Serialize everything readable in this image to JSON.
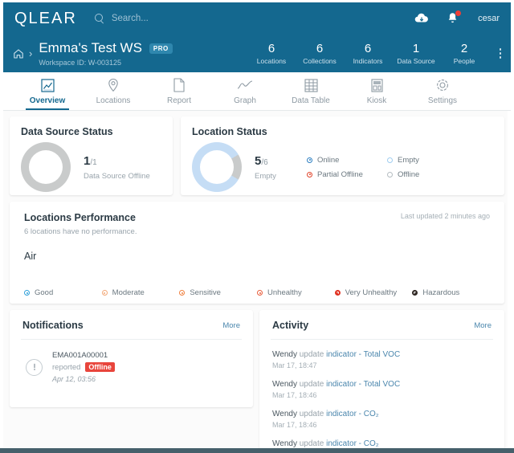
{
  "topbar": {
    "logo": "QLEAR",
    "search_placeholder": "Search...",
    "search_value": "",
    "search_icon": "search-icon",
    "cloud_icon": "cloud-download-icon",
    "bell_icon": "bell-icon",
    "username": "cesar"
  },
  "workspace": {
    "home_icon": "home-icon",
    "breadcrumb_chevron": "chevron-right-icon",
    "title": "Emma's Test WS",
    "badge": "PRO",
    "id_label": "Workspace ID: W-003125",
    "more_icon": "kebab-menu-icon",
    "stats": [
      {
        "value": "6",
        "label": "Locations"
      },
      {
        "value": "6",
        "label": "Collections"
      },
      {
        "value": "6",
        "label": "Indicators"
      },
      {
        "value": "1",
        "label": "Data Source"
      },
      {
        "value": "2",
        "label": "People"
      }
    ]
  },
  "tabs": [
    {
      "label": "Overview",
      "icon": "chart-overview-icon",
      "active": true
    },
    {
      "label": "Locations",
      "icon": "map-pin-icon",
      "active": false
    },
    {
      "label": "Report",
      "icon": "document-icon",
      "active": false
    },
    {
      "label": "Graph",
      "icon": "line-graph-icon",
      "active": false
    },
    {
      "label": "Data Table",
      "icon": "table-grid-icon",
      "active": false
    },
    {
      "label": "Kiosk",
      "icon": "kiosk-icon",
      "active": false
    },
    {
      "label": "Settings",
      "icon": "gear-icon",
      "active": false
    }
  ],
  "data_source_status": {
    "title": "Data Source Status",
    "count": "1",
    "total": "/1",
    "caption": "Data Source Offline",
    "donut_color": "#c9cbcb",
    "donut_track_color": "#c9cbcb"
  },
  "location_status": {
    "title": "Location Status",
    "count": "5",
    "total": "/6",
    "caption": "Empty",
    "donut_color": "#c5ddf5",
    "donut_remainder_color": "#c9cbcb",
    "legend": [
      {
        "label": "Online",
        "color": "#2d7fc1",
        "filled": true
      },
      {
        "label": "Empty",
        "color": "#9fcdf0",
        "filled": false
      },
      {
        "label": "Partial Offline",
        "color": "#e0452b",
        "filled": true
      },
      {
        "label": "Offline",
        "color": "#b4bcc1",
        "filled": false
      }
    ]
  },
  "locations_performance": {
    "title": "Locations Performance",
    "subtitle": "6 locations have no performance.",
    "last_updated": "Last updated 2 minutes ago",
    "section_label": "Air",
    "legend": [
      {
        "label": "Good",
        "color": "#2d9fd9"
      },
      {
        "label": "Moderate",
        "color": "#f2a878"
      },
      {
        "label": "Sensitive",
        "color": "#ef7f3d"
      },
      {
        "label": "Unhealthy",
        "color": "#e85c3a"
      },
      {
        "label": "Very Unhealthy",
        "color": "#e03020"
      },
      {
        "label": "Hazardous",
        "color": "#2e2622"
      }
    ]
  },
  "notifications": {
    "title": "Notifications",
    "more_label": "More",
    "items": [
      {
        "icon": "info-circle-icon",
        "name": "EMA001A00001",
        "action": "reported",
        "badge": "Offline",
        "time": "Apr 12, 03:56"
      }
    ]
  },
  "activity": {
    "title": "Activity",
    "more_label": "More",
    "items": [
      {
        "user": "Wendy",
        "verb": "update",
        "target": "indicator - Total VOC",
        "time": "Mar 17, 18:47"
      },
      {
        "user": "Wendy",
        "verb": "update",
        "target": "indicator - Total VOC",
        "time": "Mar 17, 18:46"
      },
      {
        "user": "Wendy",
        "verb": "update",
        "target": "indicator - CO₂",
        "time": "Mar 17, 18:46"
      },
      {
        "user": "Wendy",
        "verb": "update",
        "target": "indicator - CO₂",
        "time": ""
      }
    ]
  },
  "theme": {
    "brand_blue": "#14688f",
    "accent_link": "#4a86ad",
    "danger_red": "#e8453c",
    "footer_bar": "#46606b"
  }
}
